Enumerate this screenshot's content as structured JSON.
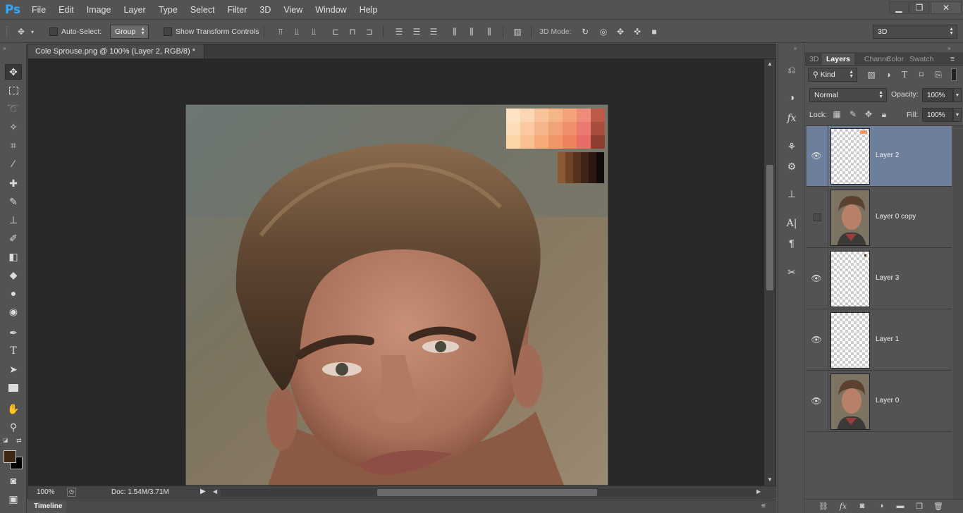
{
  "app": {
    "logo": "Ps"
  },
  "menu": [
    "File",
    "Edit",
    "Image",
    "Layer",
    "Type",
    "Select",
    "Filter",
    "3D",
    "View",
    "Window",
    "Help"
  ],
  "window_controls": {
    "minimize": "▁",
    "restore": "❐",
    "close": "✕"
  },
  "options": {
    "auto_select_label": "Auto-Select:",
    "auto_select_value": "Group",
    "show_transform_label": "Show Transform Controls",
    "mode_label": "3D Mode:",
    "workspace_value": "3D"
  },
  "document": {
    "tab_title": "Cole Sprouse.png @ 100% (Layer 2, RGB/8) *",
    "zoom": "100%",
    "doc_size": "Doc: 1.54M/3.71M",
    "timeline_label": "Timeline"
  },
  "swatches": {
    "skin": [
      [
        "#fde3c4",
        "#fbd6b3",
        "#f8c39a",
        "#f6b585",
        "#f4a378",
        "#ef8b78",
        "#bf5a4b"
      ],
      [
        "#fddcb8",
        "#fac9a3",
        "#f6b48a",
        "#f3a277",
        "#f18f6a",
        "#ea7a70",
        "#a84e3e"
      ],
      [
        "#fcd4a8",
        "#f8c090",
        "#f5aa78",
        "#f29667",
        "#ef815d",
        "#e66c66",
        "#8e3f33"
      ]
    ],
    "dark": [
      "#8a5a35",
      "#6e4428",
      "#55321e",
      "#3e2416",
      "#2a1810",
      "#120b0a"
    ]
  },
  "panel": {
    "tabs": [
      "3D",
      "Layers",
      "Channe",
      "Color",
      "Swatch"
    ],
    "active_tab": "Layers",
    "kind_label": "Kind",
    "blend_mode": "Normal",
    "opacity_label": "Opacity:",
    "opacity_value": "100%",
    "lock_label": "Lock:",
    "fill_label": "Fill:",
    "fill_value": "100%",
    "layers": [
      {
        "name": "Layer 2",
        "visible": true,
        "selected": true,
        "thumb": "swatch"
      },
      {
        "name": "Layer 0 copy",
        "visible": false,
        "selected": false,
        "thumb": "photo"
      },
      {
        "name": "Layer 3",
        "visible": true,
        "selected": false,
        "thumb": "swatch-small"
      },
      {
        "name": "Layer 1",
        "visible": true,
        "selected": false,
        "thumb": "empty"
      },
      {
        "name": "Layer 0",
        "visible": true,
        "selected": false,
        "thumb": "photo"
      }
    ]
  },
  "colors": {
    "foreground": "#3f2716",
    "background": "#000000",
    "selected_layer": "#6d7f9b"
  }
}
